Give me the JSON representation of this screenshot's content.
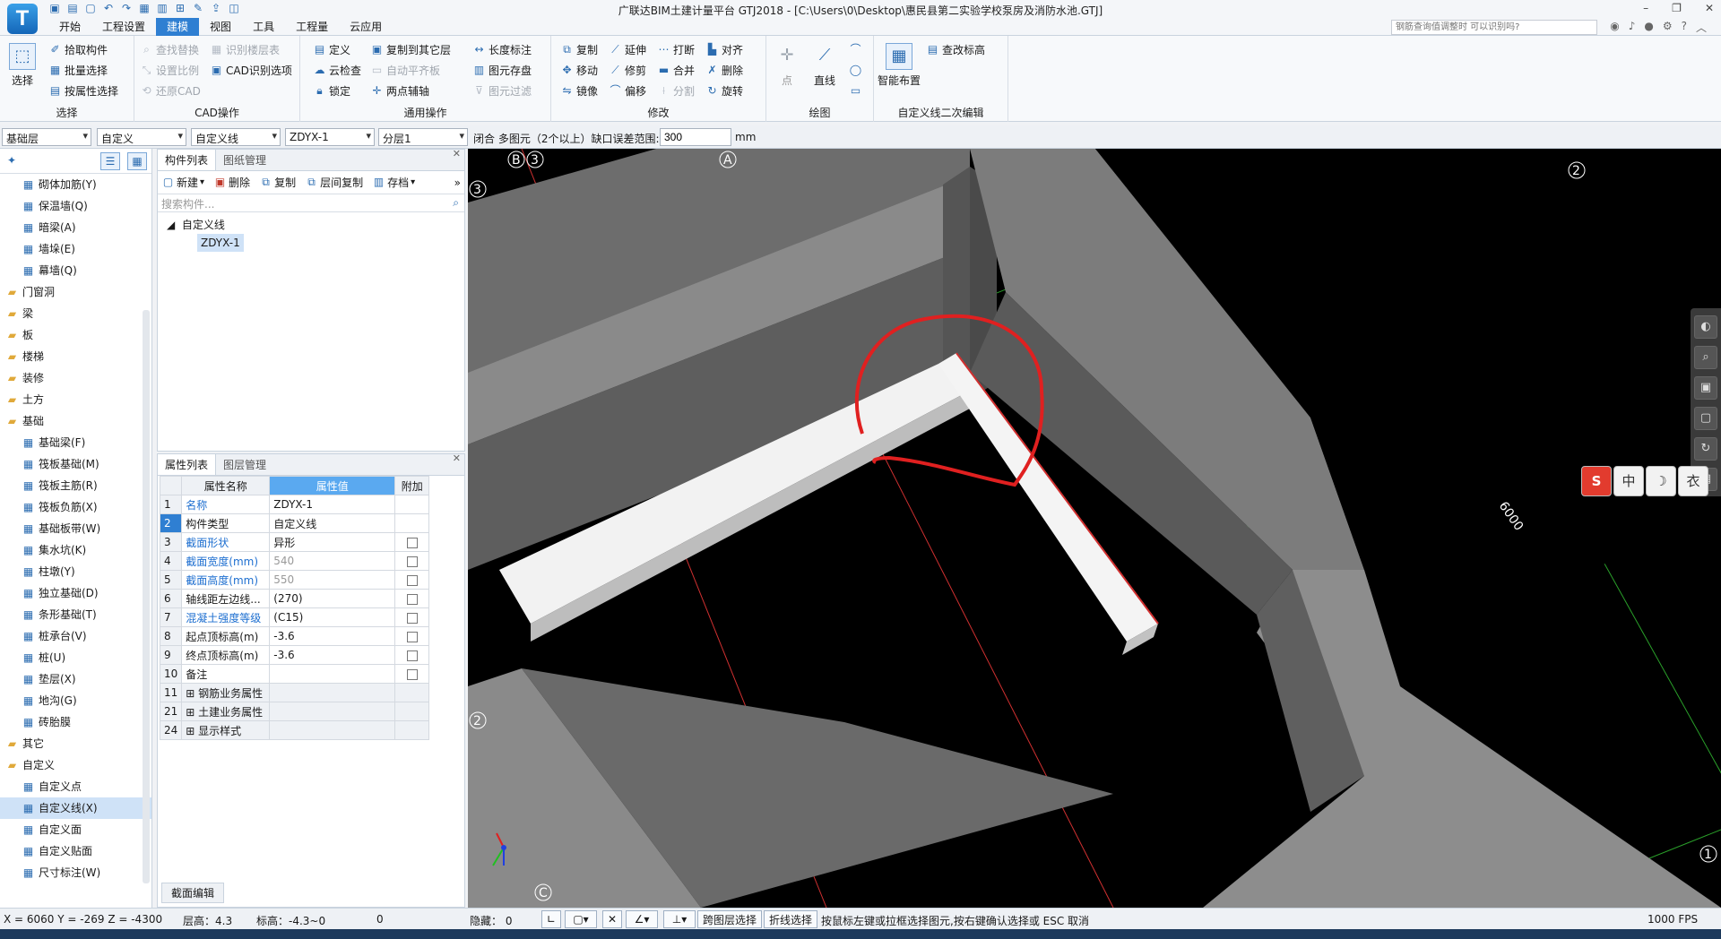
{
  "app": {
    "logo": "T",
    "title": "广联达BIM土建计量平台 GTJ2018 - [C:\\Users\\0\\Desktop\\惠民县第二实验学校泵房及消防水池.GTJ]"
  },
  "quick_access": [
    "save-icon",
    "open-icon",
    "new-icon",
    "undo-icon",
    "redo-icon",
    "table-icon",
    "grid-icon",
    "axis-icon",
    "edit-icon",
    "export-icon",
    "note-icon"
  ],
  "menu_tabs": [
    "开始",
    "工程设置",
    "建模",
    "视图",
    "工具",
    "工程量",
    "云应用"
  ],
  "help_search_placeholder": "钢筋查询值调整时 可以识别吗?",
  "ribbon": {
    "select": {
      "label": "选择",
      "big": "选择",
      "items": [
        "拾取构件",
        "批量选择",
        "按属性选择"
      ]
    },
    "cad": {
      "label": "CAD操作",
      "items": [
        "查找替换",
        "识别楼层表",
        "设置比例",
        "CAD识别选项",
        "还原CAD"
      ]
    },
    "common": {
      "label": "通用操作",
      "items": [
        "定义",
        "复制到其它层",
        "长度标注",
        "云检查",
        "自动平齐板",
        "图元存盘",
        "锁定",
        "两点辅轴",
        "图元过滤"
      ]
    },
    "modify": {
      "label": "修改",
      "items": [
        "复制",
        "延伸",
        "打断",
        "对齐",
        "移动",
        "修剪",
        "合并",
        "删除",
        "镜像",
        "偏移",
        "分割",
        "旋转"
      ]
    },
    "draw": {
      "label": "绘图",
      "items": [
        "点",
        "直线"
      ]
    },
    "custom": {
      "label": "自定义线二次编辑",
      "items": [
        "智能布置",
        "查改标高"
      ]
    }
  },
  "prop_toolbar": {
    "floor": "基础层",
    "category": "自定义",
    "type": "自定义线",
    "component": "ZDYX-1",
    "layer": "分层1",
    "text": "闭合  多图元（2个以上）缺口误差范围:",
    "gap_value": "300",
    "unit": "mm"
  },
  "tree": [
    {
      "label": "砌体加筋(Y)",
      "kind": "item"
    },
    {
      "label": "保温墙(Q)",
      "kind": "item"
    },
    {
      "label": "暗梁(A)",
      "kind": "item"
    },
    {
      "label": "墙垛(E)",
      "kind": "item"
    },
    {
      "label": "幕墙(Q)",
      "kind": "item"
    },
    {
      "label": "门窗洞",
      "kind": "cat"
    },
    {
      "label": "梁",
      "kind": "cat"
    },
    {
      "label": "板",
      "kind": "cat"
    },
    {
      "label": "楼梯",
      "kind": "cat"
    },
    {
      "label": "装修",
      "kind": "cat"
    },
    {
      "label": "土方",
      "kind": "cat"
    },
    {
      "label": "基础",
      "kind": "cat"
    },
    {
      "label": "基础梁(F)",
      "kind": "item"
    },
    {
      "label": "筏板基础(M)",
      "kind": "item"
    },
    {
      "label": "筏板主筋(R)",
      "kind": "item"
    },
    {
      "label": "筏板负筋(X)",
      "kind": "item"
    },
    {
      "label": "基础板带(W)",
      "kind": "item"
    },
    {
      "label": "集水坑(K)",
      "kind": "item"
    },
    {
      "label": "柱墩(Y)",
      "kind": "item"
    },
    {
      "label": "独立基础(D)",
      "kind": "item"
    },
    {
      "label": "条形基础(T)",
      "kind": "item"
    },
    {
      "label": "桩承台(V)",
      "kind": "item"
    },
    {
      "label": "桩(U)",
      "kind": "item"
    },
    {
      "label": "垫层(X)",
      "kind": "item"
    },
    {
      "label": "地沟(G)",
      "kind": "item"
    },
    {
      "label": "砖胎膜",
      "kind": "item"
    },
    {
      "label": "其它",
      "kind": "cat"
    },
    {
      "label": "自定义",
      "kind": "cat"
    },
    {
      "label": "自定义点",
      "kind": "item"
    },
    {
      "label": "自定义线(X)",
      "kind": "item",
      "selected": true
    },
    {
      "label": "自定义面",
      "kind": "item"
    },
    {
      "label": "自定义贴面",
      "kind": "item"
    },
    {
      "label": "尺寸标注(W)",
      "kind": "item"
    }
  ],
  "component_panel": {
    "tabs": [
      "构件列表",
      "图纸管理"
    ],
    "toolbar": [
      "新建",
      "删除",
      "复制",
      "层间复制",
      "存档"
    ],
    "search_placeholder": "搜索构件...",
    "root": "自定义线",
    "leaf": "ZDYX-1"
  },
  "property_panel": {
    "tabs": [
      "属性列表",
      "图层管理"
    ],
    "headers": [
      "属性名称",
      "属性值",
      "附加"
    ],
    "rows": [
      {
        "no": "1",
        "name": "名称",
        "value": "ZDYX-1",
        "link": true,
        "check": false
      },
      {
        "no": "2",
        "name": "构件类型",
        "value": "自定义线",
        "link": false,
        "check": false,
        "selected": true
      },
      {
        "no": "3",
        "name": "截面形状",
        "value": "异形",
        "link": true,
        "check": true
      },
      {
        "no": "4",
        "name": "截面宽度(mm)",
        "value": "540",
        "link": true,
        "check": true,
        "grey": true
      },
      {
        "no": "5",
        "name": "截面高度(mm)",
        "value": "550",
        "link": true,
        "check": true,
        "grey": true
      },
      {
        "no": "6",
        "name": "轴线距左边线...",
        "value": "(270)",
        "link": false,
        "check": true
      },
      {
        "no": "7",
        "name": "混凝土强度等级",
        "value": "(C15)",
        "link": true,
        "check": true
      },
      {
        "no": "8",
        "name": "起点顶标高(m)",
        "value": "-3.6",
        "link": false,
        "check": true
      },
      {
        "no": "9",
        "name": "终点顶标高(m)",
        "value": "-3.6",
        "link": false,
        "check": true
      },
      {
        "no": "10",
        "name": "备注",
        "value": "",
        "link": false,
        "check": true
      },
      {
        "no": "11",
        "name": "钢筋业务属性",
        "value": "",
        "link": false,
        "check": false,
        "group": true
      },
      {
        "no": "21",
        "name": "土建业务属性",
        "value": "",
        "link": false,
        "check": false,
        "group": true
      },
      {
        "no": "24",
        "name": "显示样式",
        "value": "",
        "link": false,
        "check": false,
        "group": true
      }
    ],
    "section_button": "截面编辑"
  },
  "viewport": {
    "axis_labels": [
      "B",
      "3",
      "A",
      "2",
      "3",
      "2",
      "C",
      "1"
    ],
    "dimension": "6000",
    "nav_icons": [
      "orbit-icon",
      "zoom-icon",
      "cube-icon",
      "box-icon",
      "rotate-icon",
      "layers-icon"
    ],
    "ime": [
      "S",
      "中",
      "☽",
      "衣"
    ]
  },
  "status": {
    "coords": "X = 6060 Y = -269 Z = -4300",
    "floor_height": "层高：4.3",
    "elevation": "标高：-4.3~0",
    "zero": "0",
    "hidden": "隐藏：  0",
    "cross_layer": "跨图层选择",
    "polyline": "折线选择",
    "hint": "按鼠标左键或拉框选择图元,按右键确认选择或 ESC 取消",
    "fps": "1000 FPS"
  }
}
